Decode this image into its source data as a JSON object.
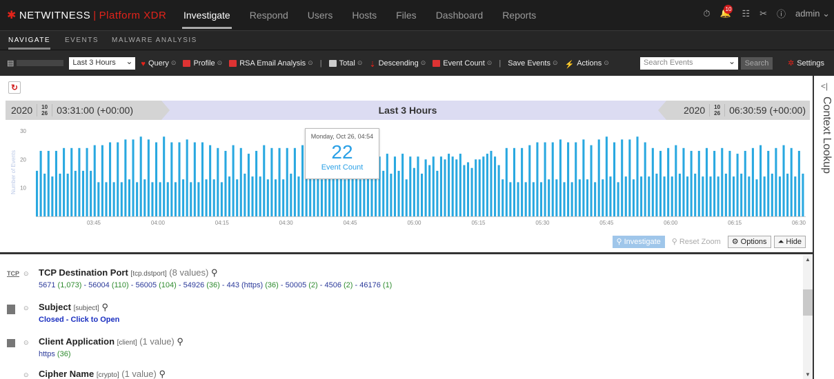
{
  "topnav": {
    "brand": "NETWITNESS",
    "brand_separator": "|",
    "brand_product": "Platform XDR",
    "menu": [
      {
        "label": "Investigate",
        "active": true
      },
      {
        "label": "Respond",
        "active": false
      },
      {
        "label": "Users",
        "active": false
      },
      {
        "label": "Hosts",
        "active": false
      },
      {
        "label": "Files",
        "active": false
      },
      {
        "label": "Dashboard",
        "active": false
      },
      {
        "label": "Reports",
        "active": false
      }
    ],
    "notification_count": "10",
    "user": "admin"
  },
  "subnav": {
    "tabs": [
      "NAVIGATE",
      "EVENTS",
      "MALWARE ANALYSIS"
    ]
  },
  "toolbar": {
    "time_range": "Last 3 Hours",
    "query": "Query",
    "profile": "Profile",
    "rsa_email": "RSA Email Analysis",
    "total": "Total",
    "descending": "Descending",
    "event_count": "Event Count",
    "save_events": "Save Events",
    "actions": "Actions",
    "search_placeholder": "Search Events",
    "search_button": "Search",
    "settings": "Settings"
  },
  "timebar": {
    "start_year": "2020",
    "start_month": "10",
    "start_day": "26",
    "start_time": "03:31:00 (+00:00)",
    "range_label": "Last 3 Hours",
    "end_year": "2020",
    "end_month": "10",
    "end_day": "26",
    "end_time": "06:30:59 (+00:00)"
  },
  "chart_data": {
    "type": "bar",
    "ylabel": "Number of Events",
    "ylim": [
      0,
      30
    ],
    "yticks": [
      "30",
      "20",
      "10"
    ],
    "xticks": [
      "03:45",
      "04:00",
      "04:15",
      "04:30",
      "04:45",
      "05:00",
      "05:15",
      "05:30",
      "05:45",
      "06:00",
      "06:15",
      "06:30"
    ],
    "color": "#29a8e0",
    "values": [
      16,
      23,
      15,
      23,
      14,
      23,
      15,
      24,
      15,
      24,
      16,
      24,
      16,
      24,
      16,
      25,
      12,
      25,
      12,
      26,
      12,
      26,
      12,
      27,
      13,
      27,
      12,
      28,
      13,
      27,
      12,
      26,
      12,
      28,
      12,
      26,
      12,
      26,
      13,
      27,
      12,
      26,
      12,
      26,
      13,
      25,
      13,
      24,
      12,
      23,
      14,
      25,
      13,
      24,
      15,
      22,
      14,
      23,
      14,
      25,
      13,
      24,
      13,
      24,
      13,
      24,
      15,
      24,
      14,
      25,
      14,
      26,
      15,
      26,
      13,
      24,
      14,
      24,
      14,
      23,
      13,
      24,
      14,
      25,
      13,
      22,
      14,
      23,
      15,
      21,
      16,
      22,
      15,
      21,
      16,
      22,
      13,
      21,
      17,
      21,
      15,
      20,
      18,
      21,
      16,
      21,
      20,
      22,
      21,
      20,
      22,
      18,
      19,
      17,
      20,
      20,
      21,
      22,
      23,
      21,
      18,
      13,
      24,
      12,
      24,
      12,
      24,
      12,
      25,
      12,
      26,
      12,
      26,
      13,
      26,
      13,
      27,
      12,
      26,
      12,
      26,
      13,
      27,
      13,
      25,
      12,
      27,
      13,
      28,
      14,
      26,
      12,
      27,
      14,
      27,
      13,
      28,
      14,
      26,
      14,
      24,
      15,
      23,
      14,
      24,
      14,
      25,
      15,
      24,
      14,
      23,
      15,
      23,
      14,
      24,
      14,
      23,
      14,
      24,
      15,
      23,
      14,
      22,
      15,
      23,
      14,
      24,
      13,
      25,
      14,
      23,
      15,
      24,
      14,
      25,
      15,
      24,
      14,
      23,
      15
    ]
  },
  "tooltip": {
    "date": "Monday, Oct 26, 04:54",
    "value": "22",
    "label": "Event Count"
  },
  "chart_buttons": {
    "investigate": "Investigate",
    "reset_zoom": "Reset Zoom",
    "options": "Options",
    "hide": "Hide"
  },
  "meta": [
    {
      "name": "TCP Destination Port",
      "key": "[tcp.dstport]",
      "count": "(8 values)",
      "icon": "TCP",
      "values": [
        {
          "v": "5671",
          "c": "(1,073)"
        },
        {
          "v": "56004",
          "c": "(110)"
        },
        {
          "v": "56005",
          "c": "(104)"
        },
        {
          "v": "54926",
          "c": "(36)"
        },
        {
          "v": "443 (https)",
          "c": "(36)"
        },
        {
          "v": "50005",
          "c": "(2)"
        },
        {
          "v": "4506",
          "c": "(2)"
        },
        {
          "v": "46176",
          "c": "(1)"
        }
      ]
    },
    {
      "name": "Subject",
      "key": "[subject]",
      "count": "",
      "closed_text": "Closed - Click to Open"
    },
    {
      "name": "Client Application",
      "key": "[client]",
      "count": "(1 value)",
      "values": [
        {
          "v": "https",
          "c": "(36)"
        }
      ]
    },
    {
      "name": "Cipher Name",
      "key": "[crypto]",
      "count": "(1 value)"
    }
  ],
  "context_lookup": "Context Lookup"
}
